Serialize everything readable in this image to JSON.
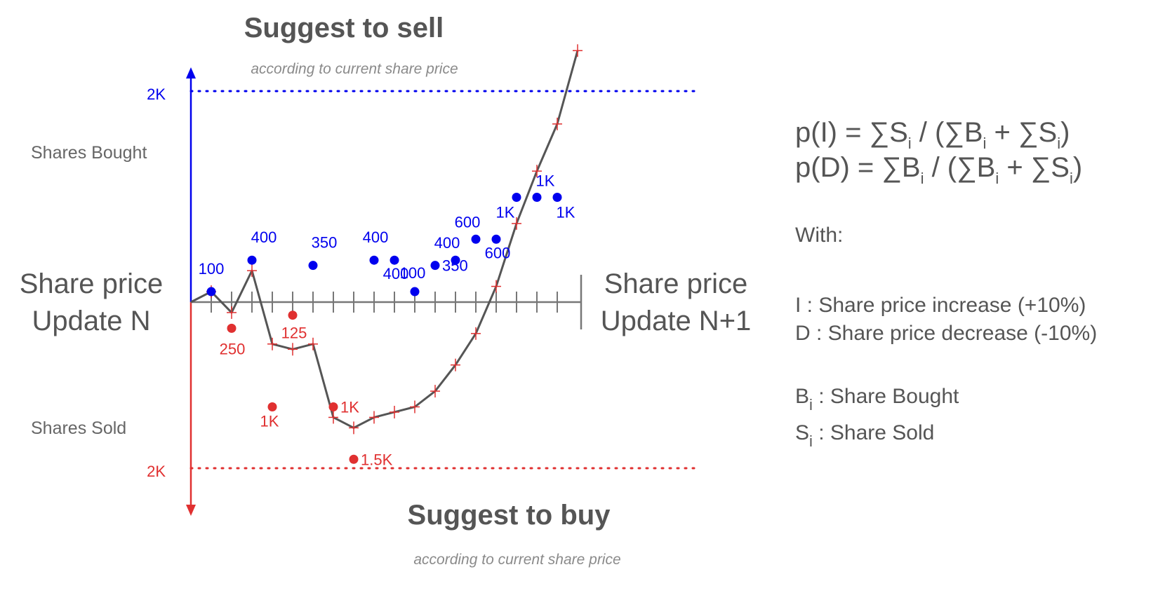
{
  "chart_data": {
    "type": "diagram",
    "title_top": "Suggest to sell",
    "subtitle_top": "according to current share price",
    "title_bottom": "Suggest to buy",
    "subtitle_bottom": "according to current share price",
    "left_label_line1": "Share price",
    "left_label_line2": "Update N",
    "right_label_line1": "Share price",
    "right_label_line2": "Update N+1",
    "axis_top_label": "Shares Bought",
    "axis_bottom_label": "Shares Sold",
    "axis_top_value": "2K",
    "axis_bottom_value": "2K",
    "tick_count": 19,
    "bought_points": [
      {
        "slot": 1,
        "value": 100,
        "label": "100"
      },
      {
        "slot": 3,
        "value": 400,
        "label": "400"
      },
      {
        "slot": 6,
        "value": 350,
        "label": "350"
      },
      {
        "slot": 9,
        "value": 400,
        "label": "400"
      },
      {
        "slot": 10,
        "value": 400,
        "label": "400"
      },
      {
        "slot": 11,
        "value": 100,
        "label": "100"
      },
      {
        "slot": 12,
        "value": 350,
        "label": "350"
      },
      {
        "slot": 13,
        "value": 400,
        "label": "400"
      },
      {
        "slot": 14,
        "value": 600,
        "label": "600"
      },
      {
        "slot": 15,
        "value": 600,
        "label": "600"
      },
      {
        "slot": 16,
        "value": 1000,
        "label": "1K"
      },
      {
        "slot": 17,
        "value": 1000,
        "label": "1K"
      },
      {
        "slot": 18,
        "value": 1000,
        "label": "1K"
      }
    ],
    "sold_points": [
      {
        "slot": 2,
        "value": 250,
        "label": "250"
      },
      {
        "slot": 5,
        "value": 125,
        "label": "125"
      },
      {
        "slot": 4,
        "value": 1000,
        "label": "1K"
      },
      {
        "slot": 7,
        "value": 1000,
        "label": "1K"
      },
      {
        "slot": 8,
        "value": 1500,
        "label": "1.5K"
      }
    ],
    "cumulative_line": [
      0,
      100,
      -100,
      300,
      -400,
      -450,
      -400,
      -1100,
      -1200,
      -1100,
      -1050,
      -1000,
      -850,
      -600,
      -300,
      150,
      750,
      1250,
      1700,
      2400
    ],
    "bought_color": "#0000ee",
    "sold_color": "#e03030",
    "line_color": "#555555"
  },
  "formulas": {
    "pI": {
      "lhs": "p(I)  = ",
      "t1": "∑S",
      "s1": "i",
      "t2": " / (∑B",
      "s2": "i",
      "t3": " + ∑S",
      "s3": "i",
      "t4": ")"
    },
    "pD": {
      "lhs": "p(D) = ",
      "t1": "∑B",
      "s1": "i",
      "t2": " / (∑B",
      "s2": "i",
      "t3": " + ∑S",
      "s3": "i",
      "t4": ")"
    }
  },
  "legend": {
    "with": "With:",
    "i_line": "I   : Share price increase (+10%)",
    "d_line": "D : Share price decrease (-10%)",
    "b_symbol": "B",
    "b_sub": "i",
    "b_text": " : Share Bought",
    "s_symbol": "S",
    "s_sub": "i",
    "s_text": " : Share Sold"
  }
}
